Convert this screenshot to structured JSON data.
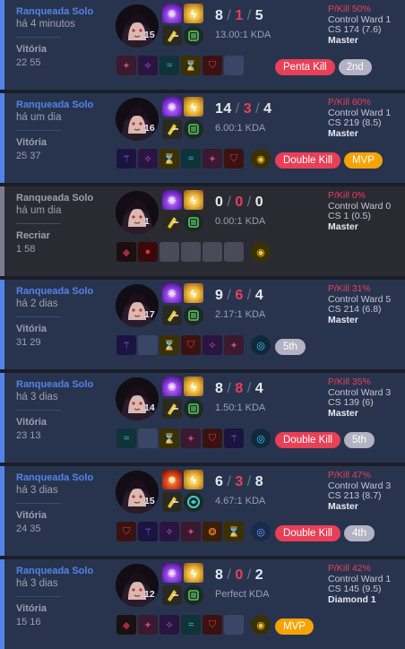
{
  "colors": {
    "win_accent": "#5383e8",
    "win_bg": "#28344e",
    "remake_accent": "#7b7a8e",
    "remake_bg": "#2a2a33",
    "death": "#e84057",
    "mvp": "#f6a300"
  },
  "matches": [
    {
      "queue": "Ranqueada Solo",
      "time": "há 4 minutos",
      "result": "Vitória",
      "duration": "22 55",
      "level": "15",
      "spell_a": "dark-harvest",
      "spell_b": "flash",
      "kills": "8",
      "deaths": "1",
      "assists": "5",
      "kda": "13.00:1 KDA",
      "pkill": "P/Kill 50%",
      "ward": "Control Ward 1",
      "cs": "CS 174 (7.6)",
      "rank": "Master",
      "remake": false,
      "items": [
        "shadowflame",
        "lich-bane",
        "stormsurge",
        "zhonya",
        "sorcerer-boots",
        "empty"
      ],
      "badges": [
        {
          "label": "Penta Kill",
          "style": "red"
        },
        {
          "label": "2nd",
          "style": "grey"
        }
      ]
    },
    {
      "queue": "Ranqueada Solo",
      "time": "há um dia",
      "result": "Vitória",
      "duration": "25 37",
      "level": "16",
      "spell_a": "dark-harvest",
      "spell_b": "flash",
      "kills": "14",
      "deaths": "3",
      "assists": "4",
      "kda": "6.00:1 KDA",
      "pkill": "P/Kill 60%",
      "ward": "Control Ward 1",
      "cs": "CS 219 (8.5)",
      "rank": "Master",
      "remake": false,
      "items": [
        "void-staff",
        "lich-bane",
        "zhonya",
        "stormsurge",
        "shadowflame",
        "sorcerer-boots"
      ],
      "ward_item": "yellow-trinket",
      "badges": [
        {
          "label": "Double Kill",
          "style": "red"
        },
        {
          "label": "MVP",
          "style": "mvp"
        }
      ]
    },
    {
      "queue": "Ranqueada Solo",
      "time": "há um dia",
      "result": "Recriar",
      "duration": "1 58",
      "level": "1",
      "spell_a": "dark-harvest",
      "spell_b": "flash",
      "kills": "0",
      "deaths": "0",
      "assists": "0",
      "kda": "0.00:1 KDA",
      "pkill": "P/Kill 0%",
      "ward": "Control Ward 0",
      "cs": "CS 1 (0.5)",
      "rank": "Master",
      "remake": true,
      "items": [
        "dark-seal",
        "health-potion",
        "empty",
        "empty",
        "empty",
        "empty"
      ],
      "ward_item": "yellow-trinket",
      "badges": []
    },
    {
      "queue": "Ranqueada Solo",
      "time": "há 2 dias",
      "result": "Vitória",
      "duration": "31 29",
      "level": "17",
      "spell_a": "dark-harvest",
      "spell_b": "flash",
      "kills": "9",
      "deaths": "6",
      "assists": "4",
      "kda": "2.17:1 KDA",
      "pkill": "P/Kill 31%",
      "ward": "Control Ward 5",
      "cs": "CS 214 (6.8)",
      "rank": "Master",
      "remake": false,
      "items": [
        "void-staff",
        "empty",
        "zhonya",
        "sorcerer-boots",
        "lich-bane",
        "shadowflame"
      ],
      "ward_item": "oracle-lens",
      "badges": [
        {
          "label": "5th",
          "style": "grey"
        }
      ]
    },
    {
      "queue": "Ranqueada Solo",
      "time": "há 3 dias",
      "result": "Vitória",
      "duration": "23 13",
      "level": "14",
      "spell_a": "dark-harvest",
      "spell_b": "flash",
      "kills": "8",
      "deaths": "8",
      "assists": "4",
      "kda": "1.50:1 KDA",
      "pkill": "P/Kill 35%",
      "ward": "Control Ward 3",
      "cs": "CS 139 (6)",
      "rank": "Master",
      "remake": false,
      "items": [
        "stormsurge",
        "empty",
        "zhonya",
        "shadowflame",
        "sorcerer-boots",
        "void-staff"
      ],
      "ward_item": "oracle-lens",
      "badges": [
        {
          "label": "Double Kill",
          "style": "red"
        },
        {
          "label": "5th",
          "style": "grey"
        }
      ]
    },
    {
      "queue": "Ranqueada Solo",
      "time": "há 3 dias",
      "result": "Vitória",
      "duration": "24 35",
      "level": "15",
      "spell_a": "ignite",
      "spell_b": "flash",
      "kills": "6",
      "deaths": "3",
      "assists": "8",
      "kda": "4.67:1 KDA",
      "pkill": "P/Kill 47%",
      "ward": "Control Ward 3",
      "cs": "CS 213 (8.7)",
      "rank": "Master",
      "remake": false,
      "items": [
        "sorcerer-boots",
        "void-staff",
        "lich-bane",
        "shadowflame",
        "nashor-tooth",
        "zhonya"
      ],
      "ward_item": "farsight",
      "badges": [
        {
          "label": "Double Kill",
          "style": "red"
        },
        {
          "label": "4th",
          "style": "grey"
        }
      ]
    },
    {
      "queue": "Ranqueada Solo",
      "time": "há 3 dias",
      "result": "Vitória",
      "duration": "15 16",
      "level": "12",
      "spell_a": "dark-harvest",
      "spell_b": "flash",
      "kills": "8",
      "deaths": "0",
      "assists": "2",
      "kda": "Perfect KDA",
      "pkill": "P/Kill 42%",
      "ward": "Control Ward 1",
      "cs": "CS 145 (9.5)",
      "rank": "Diamond 1",
      "remake": false,
      "items": [
        "dark-seal",
        "shadowflame",
        "lich-bane",
        "stormsurge",
        "sorcerer-boots",
        "empty"
      ],
      "ward_item": "yellow-trinket",
      "badges": [
        {
          "label": "MVP",
          "style": "mvp"
        }
      ]
    }
  ]
}
